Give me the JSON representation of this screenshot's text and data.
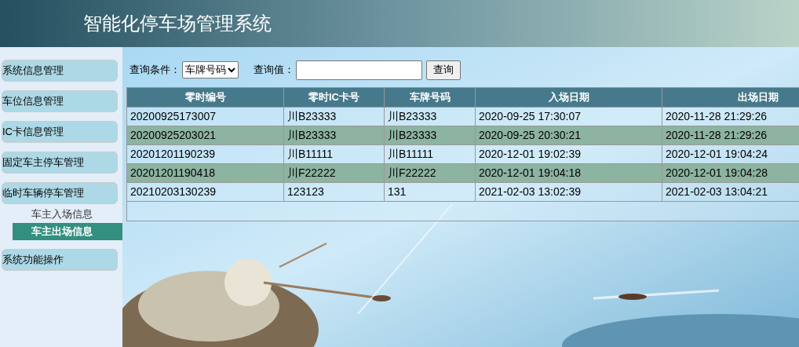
{
  "header": {
    "title": "智能化停车场管理系统"
  },
  "sidebar": {
    "items": [
      {
        "label": "系统信息管理"
      },
      {
        "label": "车位信息管理"
      },
      {
        "label": "IC卡信息管理"
      },
      {
        "label": "固定车主停车管理"
      },
      {
        "label": "临时车辆停车管理",
        "children": [
          {
            "label": "车主入场信息",
            "selected": false
          },
          {
            "label": "车主出场信息",
            "selected": true
          }
        ]
      },
      {
        "label": "系统功能操作"
      }
    ]
  },
  "search": {
    "condition_label": "查询条件：",
    "condition": "车牌号码",
    "value_label": "查询值：",
    "button": "查询"
  },
  "table": {
    "columns": [
      "零时编号",
      "零时IC卡号",
      "车牌号码",
      "入场日期",
      "出场日期"
    ],
    "rows": [
      [
        "20200925173007",
        "川B23333",
        "川B23333",
        "2020-09-25 17:30:07",
        "2020-11-28 21:29:26"
      ],
      [
        "20200925203021",
        "川B23333",
        "川B23333",
        "2020-09-25 20:30:21",
        "2020-11-28 21:29:26"
      ],
      [
        "20201201190239",
        "川B11111",
        "川B11111",
        "2020-12-01 19:02:39",
        "2020-12-01 19:04:24"
      ],
      [
        "20201201190418",
        "川F22222",
        "川F22222",
        "2020-12-01 19:04:18",
        "2020-12-01 19:04:28"
      ],
      [
        "20210203130239",
        "123123",
        "131",
        "2021-02-03 13:02:39",
        "2021-02-03 13:04:21"
      ]
    ]
  }
}
